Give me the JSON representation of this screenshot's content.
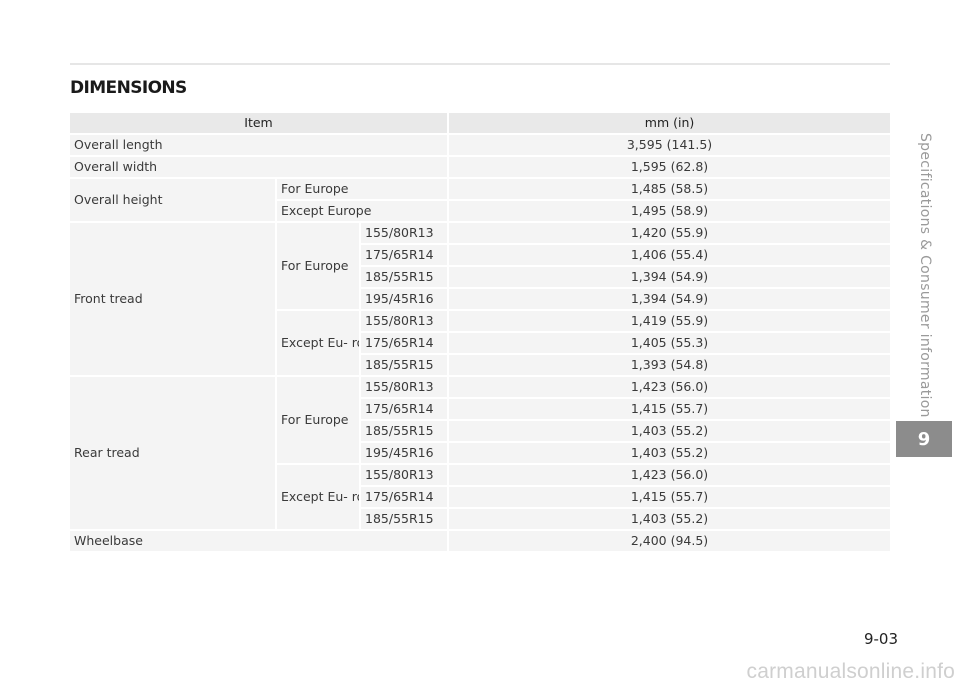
{
  "section": {
    "title": "DIMENSIONS"
  },
  "table": {
    "headers": {
      "item": "Item",
      "value": "mm (in)"
    },
    "rows": {
      "overall_length": {
        "label": "Overall length",
        "value": "3,595 (141.5)"
      },
      "overall_width": {
        "label": "Overall width",
        "value": "1,595 (62.8)"
      },
      "overall_height": {
        "label": "Overall height",
        "europe": {
          "label": "For Europe",
          "value": "1,485 (58.5)"
        },
        "except": {
          "label": "Except Europe",
          "value": "1,495 (58.9)"
        }
      },
      "front_tread": {
        "label": "Front tread",
        "europe": {
          "label": "For Europe",
          "tires": [
            {
              "tire": "155/80R13",
              "value": "1,420 (55.9)"
            },
            {
              "tire": "175/65R14",
              "value": "1,406 (55.4)"
            },
            {
              "tire": "185/55R15",
              "value": "1,394 (54.9)"
            },
            {
              "tire": "195/45R16",
              "value": "1,394 (54.9)"
            }
          ]
        },
        "except": {
          "label": "Except Eu- rope",
          "tires": [
            {
              "tire": "155/80R13",
              "value": "1,419 (55.9)"
            },
            {
              "tire": "175/65R14",
              "value": "1,405 (55.3)"
            },
            {
              "tire": "185/55R15",
              "value": "1,393 (54.8)"
            }
          ]
        }
      },
      "rear_tread": {
        "label": "Rear tread",
        "europe": {
          "label": "For Europe",
          "tires": [
            {
              "tire": "155/80R13",
              "value": "1,423 (56.0)"
            },
            {
              "tire": "175/65R14",
              "value": "1,415 (55.7)"
            },
            {
              "tire": "185/55R15",
              "value": "1,403 (55.2)"
            },
            {
              "tire": "195/45R16",
              "value": "1,403 (55.2)"
            }
          ]
        },
        "except": {
          "label": "Except Eu- rope",
          "tires": [
            {
              "tire": "155/80R13",
              "value": "1,423 (56.0)"
            },
            {
              "tire": "175/65R14",
              "value": "1,415 (55.7)"
            },
            {
              "tire": "185/55R15",
              "value": "1,403 (55.2)"
            }
          ]
        }
      },
      "wheelbase": {
        "label": "Wheelbase",
        "value": "2,400 (94.5)"
      }
    }
  },
  "sidebar": {
    "chapter_title": "Specifications & Consumer information",
    "chapter_number": "9"
  },
  "footer": {
    "page_number": "9-03",
    "watermark": "carmanualsonline.info"
  },
  "colors": {
    "header_bg": "#e9e9e9",
    "row_bg": "#f4f4f4",
    "chapter_tab_bg": "#8c8c8c",
    "side_text": "#9a9a9a",
    "watermark": "#cfcfcf"
  }
}
